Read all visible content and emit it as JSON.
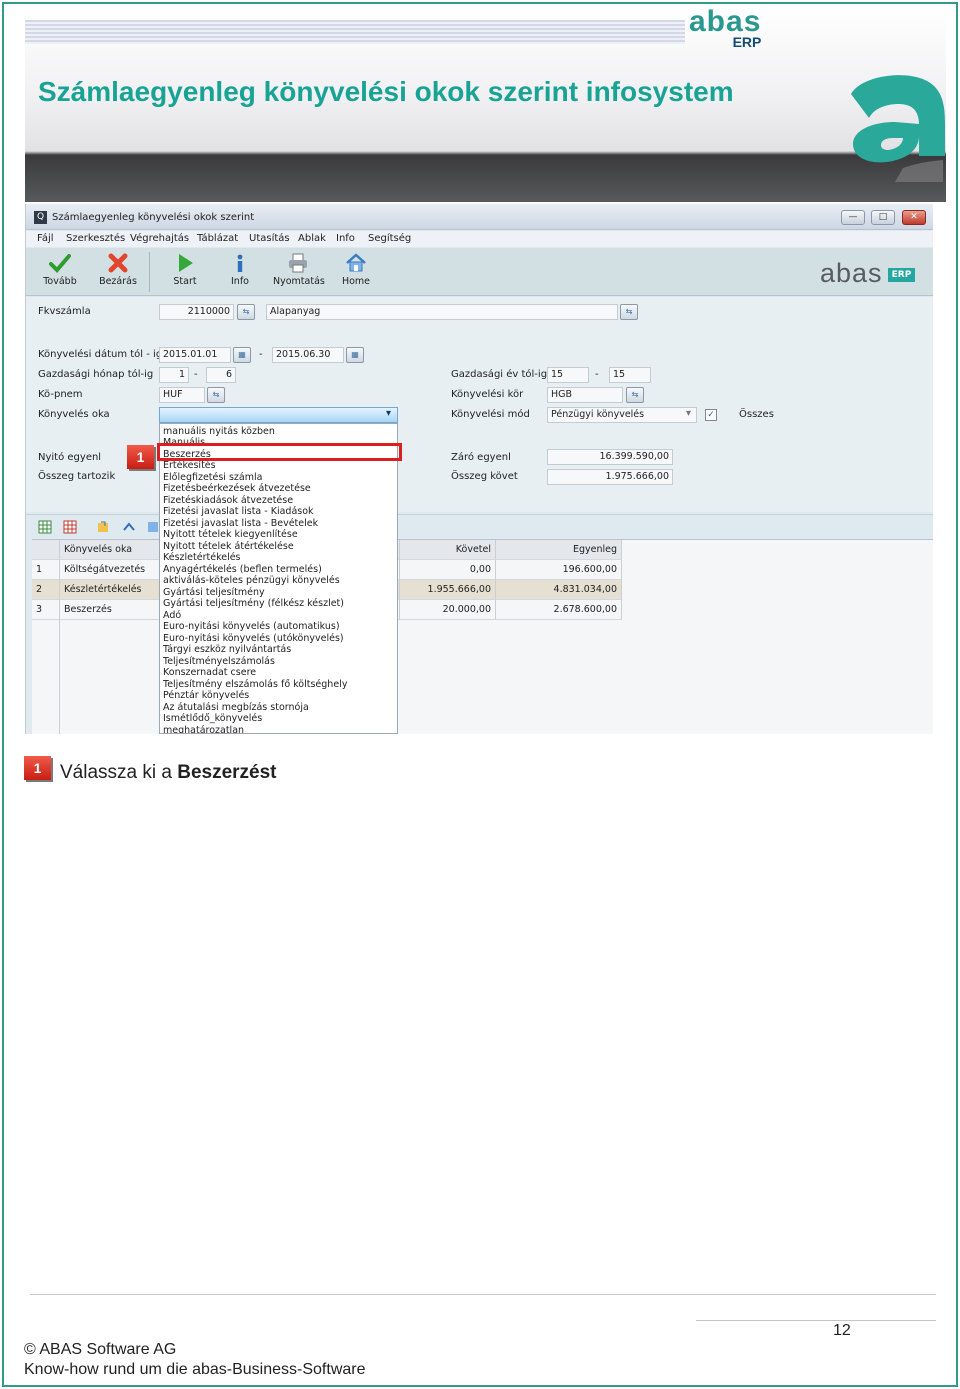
{
  "header": {
    "title": "Számlaegyenleg könyvelési okok szerint infosystem",
    "brand": "abas",
    "brand_sub": "ERP"
  },
  "window": {
    "title": "Számlaegyenleg könyvelési okok szerint",
    "minimize_glyph": "—",
    "maximize_glyph": "□",
    "close_glyph": "✕",
    "logo_text": "abas",
    "logo_badge": "ERP"
  },
  "menu": [
    "Fájl",
    "Szerkesztés",
    "Végrehajtás",
    "Táblázat",
    "Utasítás",
    "Ablak",
    "Info",
    "Segítség"
  ],
  "toolbar": {
    "items": [
      {
        "label": "Tovább",
        "icon": "check-icon"
      },
      {
        "label": "Bezárás",
        "icon": "close-x-icon"
      },
      {
        "label": "Start",
        "icon": "play-icon"
      },
      {
        "label": "Info",
        "icon": "info-icon"
      },
      {
        "label": "Nyomtatás",
        "icon": "printer-icon"
      },
      {
        "label": "Home",
        "icon": "home-icon"
      }
    ]
  },
  "form": {
    "fkvszamla_label": "Fkvszámla",
    "fkvszamla_value": "2110000",
    "fkvszamla_name": "Alapanyag",
    "date_label": "Könyvelési dátum tól - ig",
    "date_from": "2015.01.01",
    "date_to": "2015.06.30",
    "month_label": "Gazdasági hónap tól-ig",
    "month_from": "1",
    "month_to": "6",
    "currency_label": "Kö-pnem",
    "currency_value": "HUF",
    "reason_label": "Könyvelés oka",
    "reason_value": "",
    "opening_label": "Nyitó egyenl",
    "total_due_label": "Összeg tartozik",
    "fiscal_year_label": "Gazdasági év tól-ig",
    "fiscal_year_from": "15",
    "fiscal_year_to": "15",
    "circle_label": "Könyvelési kör",
    "circle_value": "HGB",
    "mode_label": "Könyvelési mód",
    "mode_value": "Pénzügyi könyvelés",
    "all_label": "Összes",
    "all_checked": "✓",
    "closing_label": "Záró egyenl",
    "closing_value": "16.399.590,00",
    "total_credit_label": "Összeg követ",
    "total_credit_value": "1.975.666,00",
    "dash": "-",
    "dropdown_arrow": "▾",
    "calendar_glyph": "▦",
    "lookup_glyph": "⇆"
  },
  "dropdown_options": [
    "manuális nyitás közben",
    "Manuális",
    "Beszerzés",
    "Értékesítés",
    "Előlegfizetési számla",
    "Fizetésbeérkezések átvezetése",
    "Fizetéskiadások átvezetése",
    "Fizetési javaslat lista - Kiadások",
    "Fizetési javaslat lista - Bevételek",
    "Nyitott tételek kiegyenlítése",
    "Nyitott tételek átértékelése",
    "Készletértékelés",
    "Anyagértékelés (beflen termelés)",
    "aktiválás-köteles pénzügyi könyvelés",
    "Gyártási teljesítmény",
    "Gyártási teljesítmény (félkész készlet)",
    "Adó",
    "Euro-nyitási könyvelés (automatikus)",
    "Euro-nyitási könyvelés (utókönyvelés)",
    "Tárgyi eszköz nyilvántartás",
    "Teljesítményelszámolás",
    "Konszernadat csere",
    "Teljesítmény elszámolás fő költséghely",
    "Pénztár könyvelés",
    "Az átutalási megbízás stornója",
    "Ismétlődő_könyvelés",
    "meghatározatlan"
  ],
  "grid": {
    "columns": [
      "Könyvelés oka",
      "Követel",
      "Egyenleg"
    ],
    "rows": [
      {
        "num": "1",
        "reason": "Költségátvezetés",
        "credit": "0,00",
        "balance": "196.600,00"
      },
      {
        "num": "2",
        "reason": "Készletértékelés",
        "credit": "1.955.666,00",
        "balance": "4.831.034,00"
      },
      {
        "num": "3",
        "reason": "Beszerzés",
        "credit": "20.000,00",
        "balance": "2.678.600,00"
      }
    ]
  },
  "callout": {
    "badge": "1",
    "instruction_prefix": "Válassza ki a",
    "instruction_bold": "Beszerzést"
  },
  "footer": {
    "page": "12",
    "copyright": "© ABAS Software AG",
    "tagline": "Know-how rund um die abas-Business-Software"
  },
  "colors": {
    "accent": "#19a395",
    "highlight": "#d82020",
    "badge": "#e0392b"
  }
}
